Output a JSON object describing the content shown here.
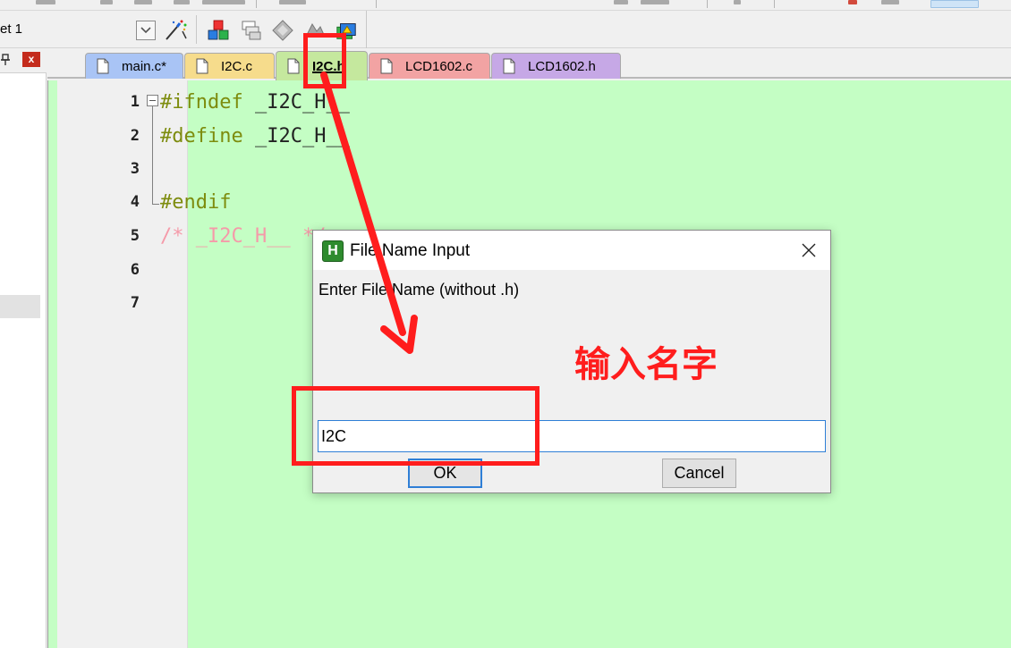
{
  "toolbar": {
    "target_label": "et 1",
    "icons": [
      "dropdown-arrow-icon",
      "wand-icon",
      "manage-components-icon",
      "window-layout-icon",
      "diamond-icon",
      "shapes-icon",
      "layers-icon"
    ]
  },
  "left_pane": {
    "pin_glyph": "ᵖ",
    "close_glyph": "x"
  },
  "tabs": [
    {
      "label": "main.c*",
      "color": "#a9c4f5",
      "active": false
    },
    {
      "label": "I2C.c",
      "color": "#f6dc8c",
      "active": false
    },
    {
      "label": "I2C.h",
      "color": "#c5e89e",
      "active": true
    },
    {
      "label": "LCD1602.c",
      "color": "#f2a3a3",
      "active": false
    },
    {
      "label": "LCD1602.h",
      "color": "#c6a8e6",
      "active": false
    }
  ],
  "editor": {
    "background": "#c4fec4",
    "line_numbers": [
      "1",
      "2",
      "3",
      "4",
      "5",
      "6",
      "7"
    ],
    "lines": [
      {
        "directive": "#ifndef",
        "ident": "_I2C_H__",
        "comment": ""
      },
      {
        "directive": "#define",
        "ident": "_I2C_H__",
        "comment": ""
      },
      {
        "directive": "",
        "ident": "",
        "comment": ""
      },
      {
        "directive": "#endif",
        "ident": "",
        "comment": ""
      },
      {
        "directive": "",
        "ident": "",
        "comment": "/* _I2C_H__ */"
      },
      {
        "directive": "",
        "ident": "",
        "comment": ""
      },
      {
        "directive": "",
        "ident": "",
        "comment": ""
      }
    ]
  },
  "dialog": {
    "title": "File Name Input",
    "app_icon_letter": "H",
    "prompt": "Enter File Name (without .h)",
    "input_value": "I2C",
    "ok_label": "OK",
    "cancel_label": "Cancel"
  },
  "annotation": {
    "text": "输入名字",
    "color": "#ff1d1d"
  }
}
